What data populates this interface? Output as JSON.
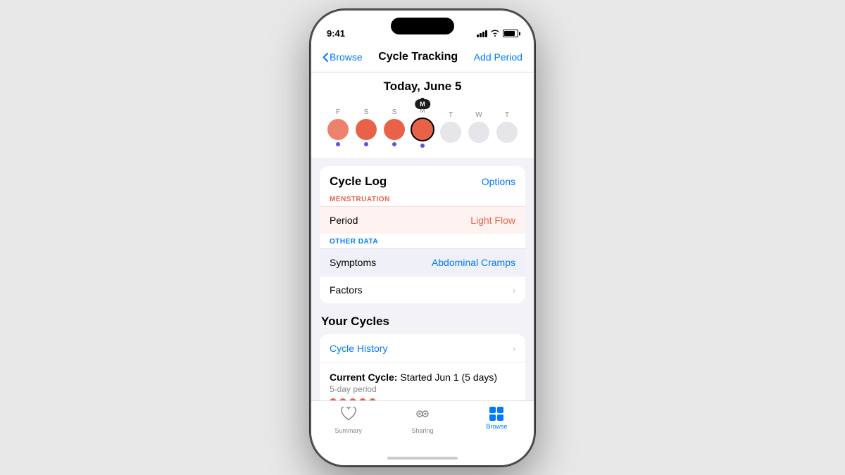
{
  "statusBar": {
    "time": "9:41",
    "battery": "full"
  },
  "navBar": {
    "backLabel": "Browse",
    "title": "Cycle Tracking",
    "actionLabel": "Add Period"
  },
  "calendar": {
    "dateTitle": "Today, June 5",
    "days": [
      {
        "letter": "F",
        "type": "period-light",
        "dot": true
      },
      {
        "letter": "S",
        "type": "period-medium",
        "dot": true
      },
      {
        "letter": "S",
        "type": "period-medium",
        "dot": true
      },
      {
        "letter": "M",
        "type": "period-today",
        "dot": true,
        "today": true
      },
      {
        "letter": "T",
        "type": "future-empty",
        "dot": false
      },
      {
        "letter": "W",
        "type": "future-empty",
        "dot": false
      },
      {
        "letter": "T",
        "type": "future-empty",
        "dot": false
      }
    ]
  },
  "cycleLog": {
    "sectionTitle": "Cycle Log",
    "optionsLabel": "Options",
    "menstruationLabel": "MENSTRUATION",
    "periodRowLabel": "Period",
    "periodRowValue": "Light Flow",
    "otherDataLabel": "OTHER DATA",
    "symptomsRowLabel": "Symptoms",
    "symptomsRowValue": "Abdominal Cramps",
    "factorsRowLabel": "Factors"
  },
  "yourCycles": {
    "sectionTitle": "Your Cycles",
    "historyLabel": "Cycle History",
    "currentCycleLabel": "Current Cycle:",
    "currentCycleValue": "Started Jun 1 (5 days)",
    "periodSub": "5-day period"
  },
  "tabBar": {
    "tabs": [
      {
        "label": "Summary",
        "icon": "heart",
        "active": false
      },
      {
        "label": "Sharing",
        "icon": "sharing",
        "active": false
      },
      {
        "label": "Browse",
        "icon": "grid",
        "active": true
      }
    ]
  }
}
